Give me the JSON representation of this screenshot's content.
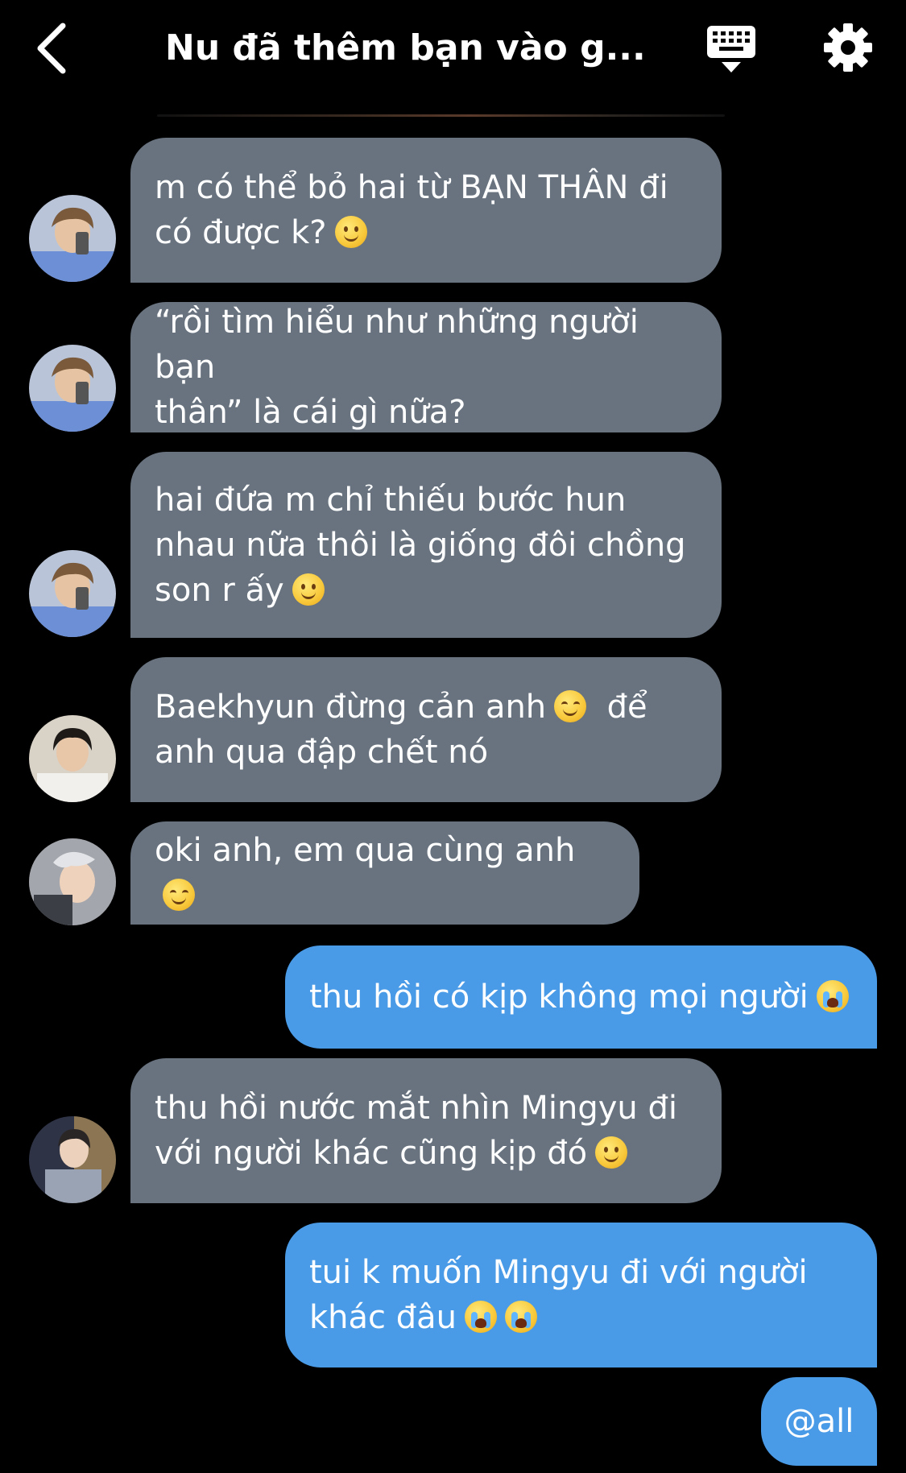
{
  "header": {
    "title": "Nu đã thêm bạn vào g...",
    "back_icon": "chevron-left-icon",
    "keyboard_icon": "keyboard-icon",
    "settings_icon": "gear-icon"
  },
  "messages": [
    {
      "dir": "in",
      "avatar": "avatar-1",
      "lines": [
        "m có thể bỏ hai từ BẠN THÂN đi",
        "có được k?"
      ],
      "emoji": "slight-smile"
    },
    {
      "dir": "in",
      "avatar": "avatar-1",
      "lines": [
        "“rồi tìm hiểu như những người bạn",
        "thân” là cái gì nữa?"
      ]
    },
    {
      "dir": "in",
      "avatar": "avatar-1",
      "lines": [
        "hai đứa m chỉ thiếu bước hun",
        "nhau nữa thôi là giống đôi chồng",
        "son r ấy"
      ],
      "emoji": "slight-smile"
    },
    {
      "dir": "in",
      "avatar": "avatar-2",
      "lines": [
        "Baekhyun đừng cản anh",
        "để",
        "anh qua đập chết nó"
      ],
      "emoji": "blush"
    },
    {
      "dir": "in",
      "avatar": "avatar-3",
      "lines": [
        "oki anh, em qua cùng anh"
      ],
      "emoji": "blush"
    },
    {
      "dir": "out",
      "lines": [
        "thu hồi có kịp không mọi người"
      ],
      "emoji": "cry"
    },
    {
      "dir": "in",
      "avatar": "avatar-4",
      "lines": [
        "thu hồi nước mắt nhìn Mingyu đi",
        "với người khác cũng kịp đó"
      ],
      "emoji": "slight-smile"
    },
    {
      "dir": "out",
      "lines": [
        "tui k muốn Mingyu đi với người",
        "khác đâu"
      ],
      "emoji": "cry"
    },
    {
      "dir": "out",
      "lines": [
        "@all"
      ]
    }
  ],
  "colors": {
    "background": "#000000",
    "incoming_bubble": "#68737f",
    "outgoing_bubble": "#4a9be7",
    "text": "#ffffff"
  }
}
